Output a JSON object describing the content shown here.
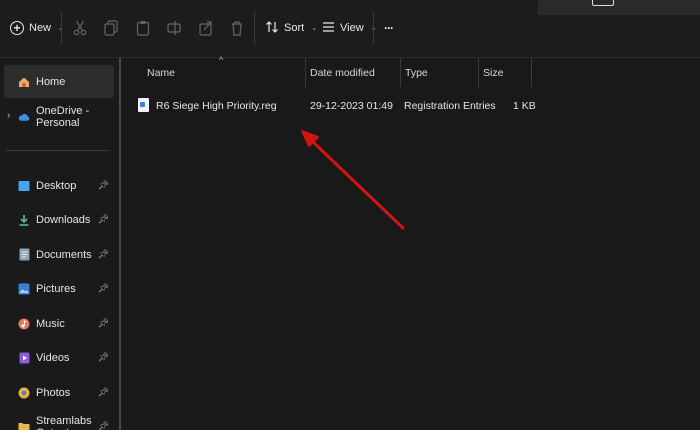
{
  "toolbar": {
    "new_label": "New",
    "sort_label": "Sort",
    "view_label": "View",
    "more_label": "···",
    "caret": "⌄"
  },
  "sidebar": {
    "items": [
      {
        "label": "Home",
        "icon": "home-icon",
        "pinned": false,
        "selected": true
      },
      {
        "label": "OneDrive - Personal",
        "icon": "cloud-icon",
        "pinned": false,
        "selected": false
      },
      {
        "label": "Desktop",
        "icon": "desktop-icon",
        "pinned": true
      },
      {
        "label": "Downloads",
        "icon": "download-icon",
        "pinned": true
      },
      {
        "label": "Documents",
        "icon": "document-icon",
        "pinned": true
      },
      {
        "label": "Pictures",
        "icon": "picture-icon",
        "pinned": true
      },
      {
        "label": "Music",
        "icon": "music-icon",
        "pinned": true
      },
      {
        "label": "Videos",
        "icon": "video-icon",
        "pinned": true
      },
      {
        "label": "Photos",
        "icon": "photos-icon",
        "pinned": true
      },
      {
        "label": "Streamlabs Output",
        "icon": "folder-icon",
        "pinned": true
      }
    ]
  },
  "columns": {
    "name": "Name",
    "date": "Date modified",
    "type": "Type",
    "size": "Size"
  },
  "files": [
    {
      "name": "R6 Siege High Priority.reg",
      "date": "29-12-2023 01:49",
      "type": "Registration Entries",
      "size": "1 KB"
    }
  ],
  "colors": {
    "background": "#191919",
    "annotation_arrow": "#d41414",
    "selection": "#2d2d2d"
  }
}
